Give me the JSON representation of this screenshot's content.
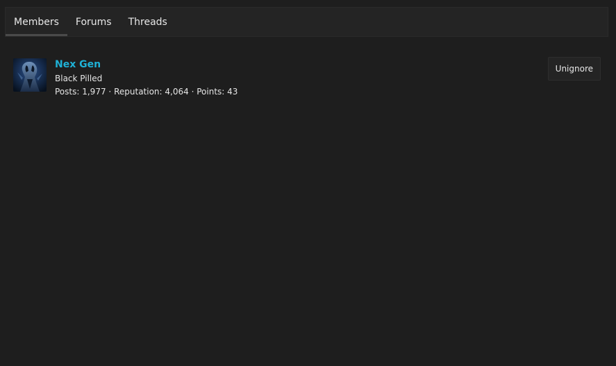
{
  "tabs": [
    {
      "label": "Members",
      "active": true
    },
    {
      "label": "Forums",
      "active": false
    },
    {
      "label": "Threads",
      "active": false
    }
  ],
  "member": {
    "username": "Nex Gen",
    "title": "Black Pilled",
    "posts_label": "Posts:",
    "posts": "1,977",
    "reputation_label": "Reputation:",
    "reputation": "4,064",
    "points_label": "Points:",
    "points": "43",
    "separator": "·",
    "avatar_icon": "alien-avatar-icon"
  },
  "actions": {
    "unignore_label": "Unignore"
  },
  "colors": {
    "background": "#1e1e1e",
    "username": "#1fb1d6",
    "tabbar": "#242424"
  }
}
